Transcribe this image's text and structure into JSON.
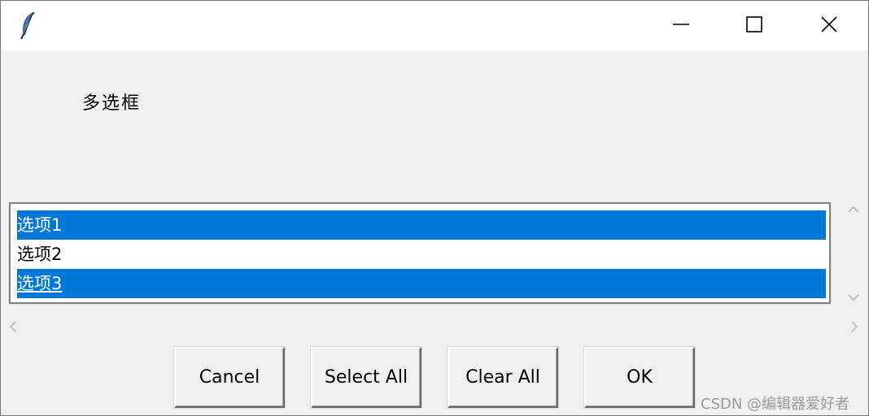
{
  "window": {
    "app_icon": "feather-icon",
    "controls": {
      "minimize": "minimize-icon",
      "maximize": "maximize-icon",
      "close": "close-icon"
    }
  },
  "dialog": {
    "prompt": "多选框"
  },
  "listbox": {
    "items": [
      {
        "label": "选项1",
        "selected": true,
        "active": false
      },
      {
        "label": "选项2",
        "selected": false,
        "active": false
      },
      {
        "label": "选项3",
        "selected": true,
        "active": true
      }
    ],
    "selection_color": "#0078d7"
  },
  "buttons": {
    "cancel": "Cancel",
    "select_all": "Select All",
    "clear_all": "Clear All",
    "ok": "OK"
  },
  "watermark": "CSDN @编辑器爱好者"
}
